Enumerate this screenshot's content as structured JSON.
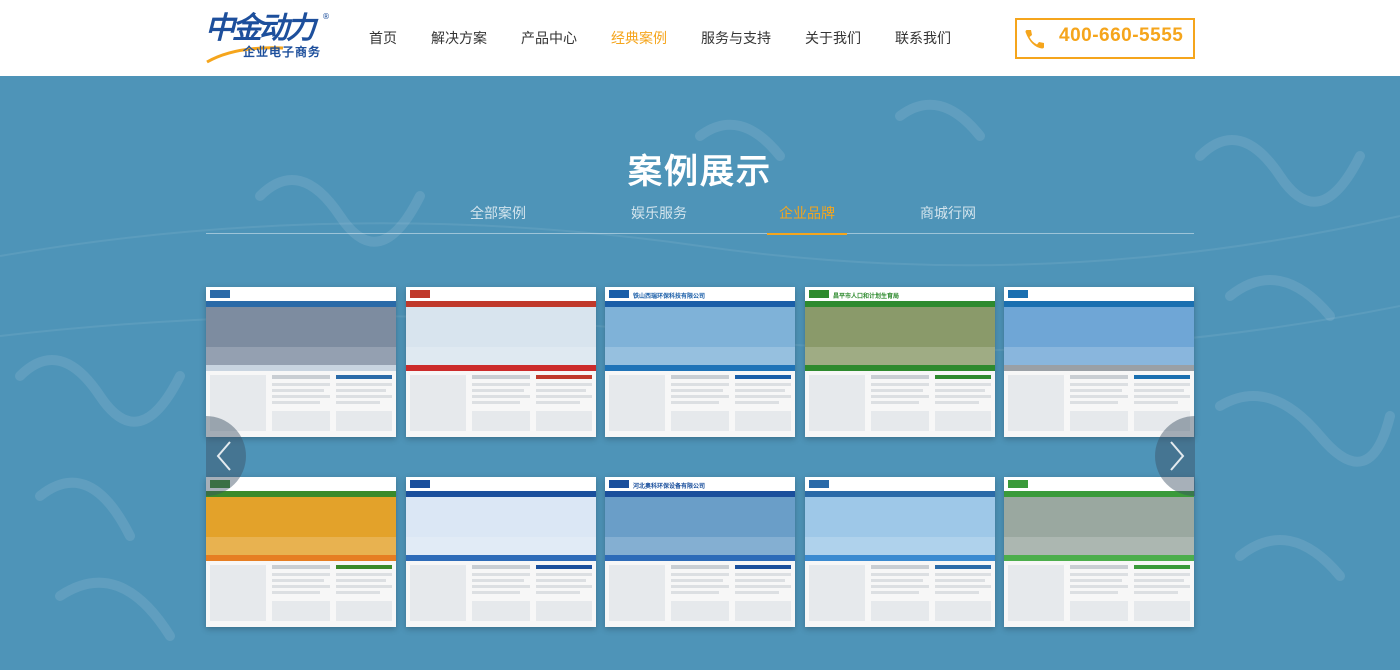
{
  "header": {
    "logo": {
      "title": "中金动力",
      "subtitle": "企业电子商务",
      "reg": "®"
    },
    "nav": [
      {
        "label": "首页",
        "active": false
      },
      {
        "label": "解决方案",
        "active": false
      },
      {
        "label": "产品中心",
        "active": false
      },
      {
        "label": "经典案例",
        "active": true
      },
      {
        "label": "服务与支持",
        "active": false
      },
      {
        "label": "关于我们",
        "active": false
      },
      {
        "label": "联系我们",
        "active": false
      }
    ],
    "phone": {
      "icon": "phone-icon",
      "number": "400-660-5555"
    }
  },
  "main": {
    "title": "案例展示",
    "tabs": [
      {
        "label": "全部案例",
        "active": false
      },
      {
        "label": "娱乐服务",
        "active": false
      },
      {
        "label": "企业品牌",
        "active": true
      },
      {
        "label": "商城行网",
        "active": false
      }
    ],
    "prev_icon": "chevron-left-icon",
    "next_icon": "chevron-right-icon",
    "cases": [
      {
        "label": "",
        "theme": "#2a6aa8",
        "hero": "#7d8ca0",
        "accent": "#c8d4e0"
      },
      {
        "label": "",
        "theme": "#c0392b",
        "hero": "#d8e4ee",
        "accent": "#cc2b2b"
      },
      {
        "label": "铁山西瑞环保科技有限公司",
        "theme": "#1a5ea8",
        "hero": "#7fb2d8",
        "accent": "#1f73b7"
      },
      {
        "label": "昌平市人口和计划生育局",
        "theme": "#2e8a2e",
        "hero": "#8a9a6a",
        "accent": "#2e8a2e"
      },
      {
        "label": "",
        "theme": "#1a6fb0",
        "hero": "#6fa6d6",
        "accent": "#9aa0a6"
      },
      {
        "label": "",
        "theme": "#3a8a2a",
        "hero": "#e3a22a",
        "accent": "#e67e22"
      },
      {
        "label": "",
        "theme": "#1a4f9c",
        "hero": "#dbe7f5",
        "accent": "#2d6bb8"
      },
      {
        "label": "河北奥科环保设备有限公司",
        "theme": "#1a4f9c",
        "hero": "#6a9ec8",
        "accent": "#2d6bb8"
      },
      {
        "label": "",
        "theme": "#2a6aa8",
        "hero": "#9ec8e8",
        "accent": "#3a8ad0"
      },
      {
        "label": "",
        "theme": "#3a9a3a",
        "hero": "#9aa8a0",
        "accent": "#4cae4c"
      }
    ]
  },
  "colors": {
    "accent": "#f5a51c",
    "banner": "#4e94b8",
    "logo": "#1d4f9c"
  }
}
